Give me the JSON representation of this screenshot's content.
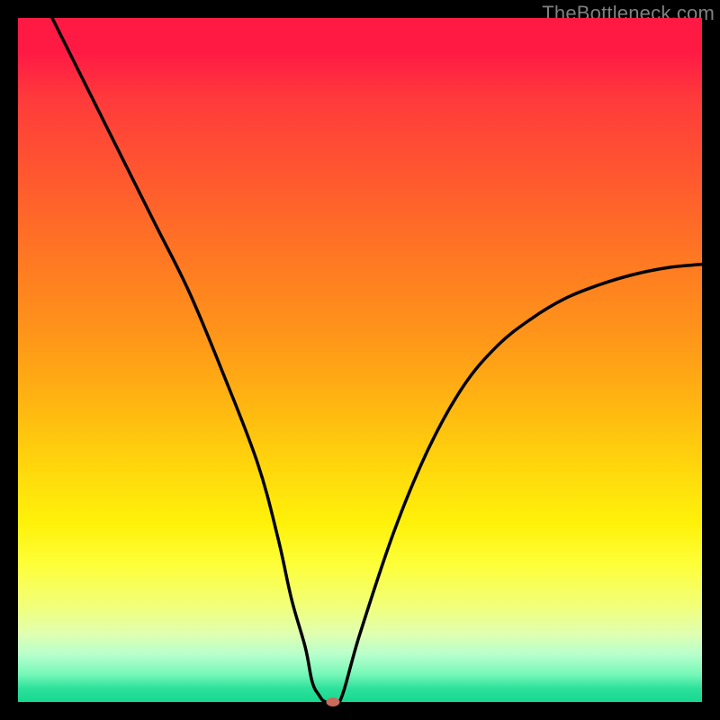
{
  "watermark": "TheBottleneck.com",
  "chart_data": {
    "type": "line",
    "title": "",
    "xlabel": "",
    "ylabel": "",
    "xlim": [
      0,
      100
    ],
    "ylim": [
      0,
      100
    ],
    "x": [
      5,
      10,
      15,
      20,
      25,
      30,
      35,
      38,
      40,
      42,
      43,
      44,
      45,
      47,
      50,
      55,
      60,
      65,
      70,
      75,
      80,
      85,
      90,
      95,
      100
    ],
    "y": [
      100,
      90,
      80,
      70,
      60,
      48,
      35,
      24,
      15,
      8,
      3,
      1,
      0,
      0,
      10,
      25,
      37,
      46,
      52,
      56,
      59,
      61,
      62.5,
      63.5,
      64
    ],
    "marker": {
      "x": 46,
      "y": 0
    },
    "gradient_stops": [
      {
        "pos": 0,
        "color": "#ff1a44"
      },
      {
        "pos": 50,
        "color": "#ff9a18"
      },
      {
        "pos": 75,
        "color": "#fff20a"
      },
      {
        "pos": 100,
        "color": "#16d890"
      }
    ]
  }
}
